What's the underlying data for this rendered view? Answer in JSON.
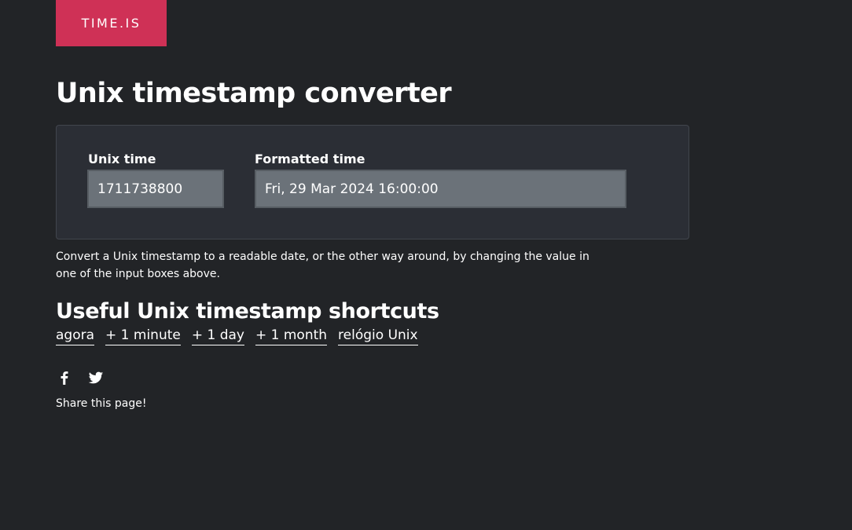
{
  "header": {
    "logo_text": "TIME.IS",
    "logo_color": "#cf3156"
  },
  "page": {
    "title": "Unix timestamp converter",
    "background_color": "#222427"
  },
  "converter": {
    "unix_label": "Unix time",
    "unix_value": "1711738800",
    "formatted_label": "Formatted time",
    "formatted_value": "Fri, 29 Mar 2024 16:00:00"
  },
  "description": "Convert a Unix timestamp to a readable date, or the other way around, by changing the value in one of the input boxes above.",
  "shortcuts": {
    "heading": "Useful Unix timestamp shortcuts",
    "links": [
      "agora",
      "+ 1 minute",
      "+ 1 day",
      "+ 1 month",
      "relógio Unix"
    ]
  },
  "social": {
    "icons": [
      "facebook-icon",
      "twitter-icon"
    ],
    "share_text": "Share this page!"
  }
}
